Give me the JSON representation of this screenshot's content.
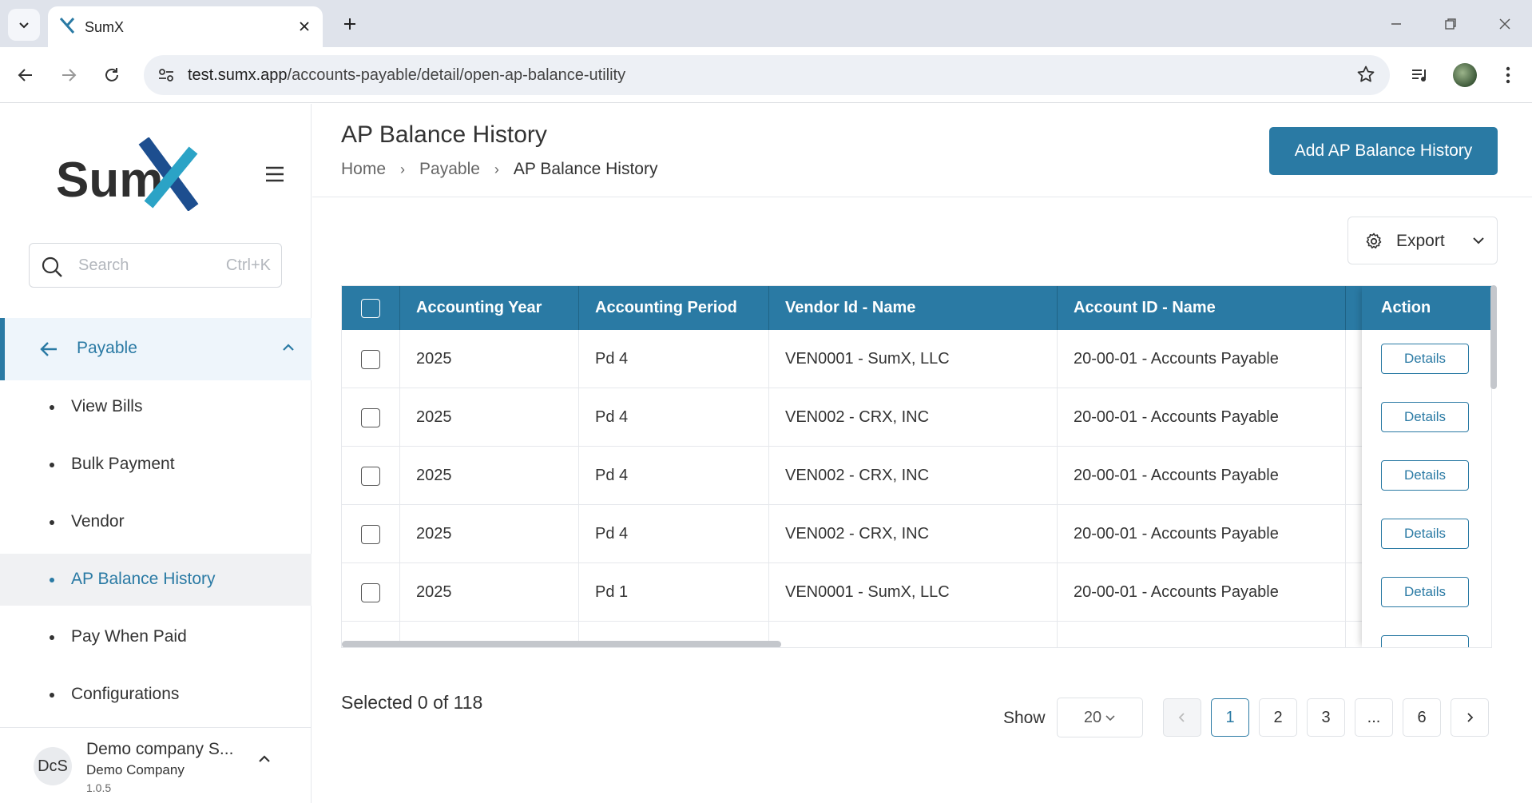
{
  "browser": {
    "tab_title": "SumX",
    "url_host": "test.sumx.app",
    "url_path": "/accounts-payable/detail/open-ap-balance-utility"
  },
  "sidebar": {
    "logo_text": "SumX",
    "search_placeholder": "Search",
    "search_shortcut": "Ctrl+K",
    "group_label": "Payable",
    "items": [
      {
        "label": "View Bills"
      },
      {
        "label": "Bulk Payment"
      },
      {
        "label": "Vendor"
      },
      {
        "label": "AP Balance History",
        "active": true
      },
      {
        "label": "Pay When Paid"
      },
      {
        "label": "Configurations"
      }
    ],
    "company": {
      "initials": "DcS",
      "name": "Demo company S...",
      "subtitle": "Demo Company",
      "version": "1.0.5"
    }
  },
  "header": {
    "title": "AP Balance History",
    "breadcrumb": [
      "Home",
      "Payable",
      "AP Balance History"
    ],
    "add_button": "Add AP Balance History"
  },
  "export_label": "Export",
  "table": {
    "columns": [
      "Accounting Year",
      "Accounting Period",
      "Vendor Id - Name",
      "Account ID - Name"
    ],
    "action_header": "Action",
    "action_label": "Details",
    "rows": [
      [
        "2025",
        "Pd 4",
        "VEN0001 - SumX, LLC",
        "20-00-01 - Accounts Payable"
      ],
      [
        "2025",
        "Pd 4",
        "VEN002 - CRX, INC",
        "20-00-01 - Accounts Payable"
      ],
      [
        "2025",
        "Pd 4",
        "VEN002 - CRX, INC",
        "20-00-01 - Accounts Payable"
      ],
      [
        "2025",
        "Pd 4",
        "VEN002 - CRX, INC",
        "20-00-01 - Accounts Payable"
      ],
      [
        "2025",
        "Pd 1",
        "VEN0001 - SumX, LLC",
        "20-00-01 - Accounts Payable"
      ]
    ]
  },
  "footer": {
    "selected_text": "Selected 0 of 118",
    "show_label": "Show",
    "page_size": "20",
    "pages": [
      "1",
      "2",
      "3",
      "...",
      "6"
    ],
    "current_page": "1"
  },
  "colors": {
    "accent": "#2a7aa4",
    "header_bg": "#2a7aa4"
  }
}
